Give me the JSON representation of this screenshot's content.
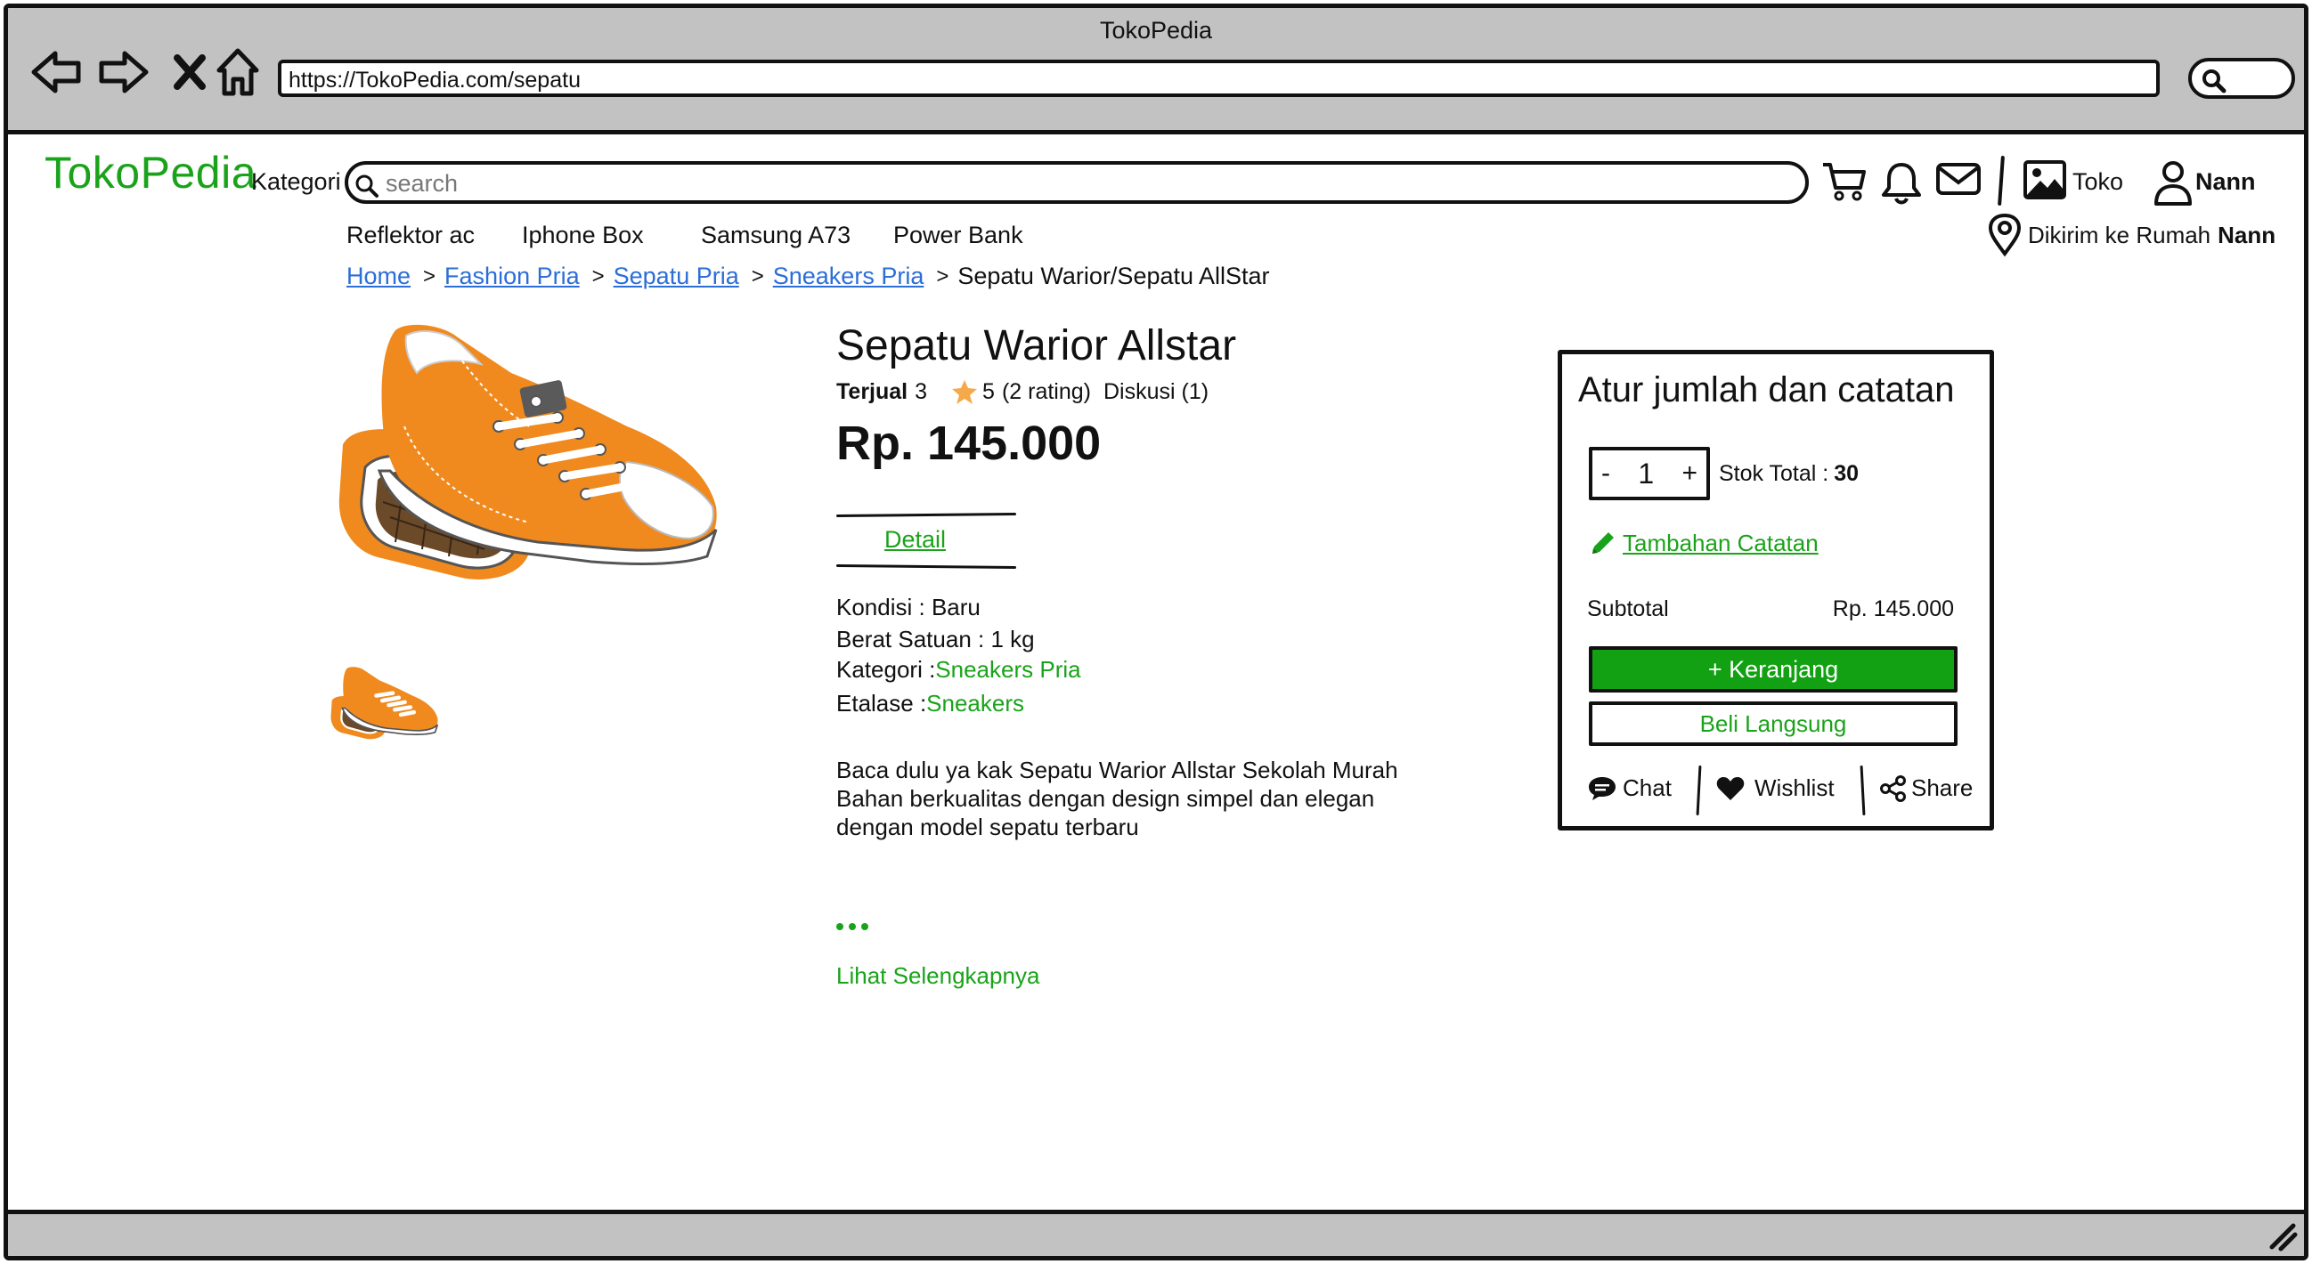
{
  "browser": {
    "window_title": "TokoPedia",
    "url": "https://TokoPedia.com/sepatu"
  },
  "header": {
    "logo": "TokoPedia",
    "category_label": "Kategori",
    "search_placeholder": "search",
    "store_label": "Toko",
    "user_name": "Nann"
  },
  "quick_links": [
    "Reflektor ac",
    "Iphone Box",
    "Samsung A73",
    "Power Bank"
  ],
  "shipping": {
    "label": "Dikirim ke Rumah",
    "name": "Nann"
  },
  "breadcrumb": [
    "Home",
    "Fashion Pria",
    "Sepatu Pria",
    "Sneakers Pria",
    "Sepatu Warior/Sepatu AllStar"
  ],
  "product": {
    "title": "Sepatu Warior Allstar",
    "sold_label": "Terjual",
    "sold_count": "3",
    "rating": "5",
    "rating_count": "(2 rating)",
    "discussion": "Diskusi (1)",
    "price": "Rp. 145.000",
    "tab_detail": "Detail",
    "condition_label": "Kondisi : Baru",
    "weight_label": "Berat Satuan : 1 kg",
    "category_label": "Kategori :",
    "category_value": "Sneakers Pria",
    "showcase_label": "Etalase :",
    "showcase_value": "Sneakers",
    "description": [
      "Baca dulu ya kak Sepatu Warior Allstar Sekolah Murah",
      "Bahan berkualitas dengan design simpel dan elegan",
      "dengan model sepatu terbaru"
    ],
    "see_more": "Lihat Selengkapnya"
  },
  "purchase_card": {
    "title": "Atur jumlah dan catatan",
    "minus": "-",
    "quantity": "1",
    "plus": "+",
    "stock_label": "Stok Total :",
    "stock_value": "30",
    "add_note": "Tambahan Catatan",
    "subtotal_label": "Subtotal",
    "subtotal_value": "Rp. 145.000",
    "add_to_cart": "+ Keranjang",
    "buy_now": "Beli Langsung",
    "chat": "Chat",
    "wishlist": "Wishlist",
    "share": "Share"
  },
  "colors": {
    "brand_green": "#1aa31a",
    "link_blue": "#2b6ed8",
    "chrome_gray": "#c2c2c2",
    "shoe_orange": "#f08a1e"
  },
  "icons": [
    "back-arrow-icon",
    "forward-arrow-icon",
    "close-icon",
    "home-icon",
    "search-icon",
    "cart-icon",
    "bell-icon",
    "mail-icon",
    "image-icon",
    "user-icon",
    "location-pin-icon",
    "star-icon",
    "pencil-icon",
    "chat-icon",
    "heart-icon",
    "share-icon",
    "resize-grip-icon"
  ]
}
